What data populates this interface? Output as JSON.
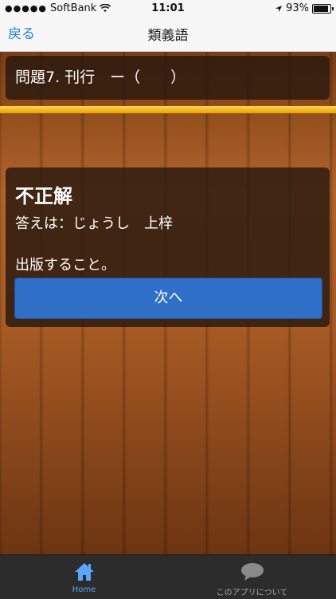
{
  "status": {
    "carrier": "SoftBank",
    "time": "11:01",
    "battery": "93%"
  },
  "nav": {
    "back_label": "戻る",
    "title": "類義語"
  },
  "question": {
    "text": "問題7. 刊行　ー（　　）"
  },
  "progress": {
    "fraction": 1.0
  },
  "result": {
    "title": "不正解",
    "answer": "答えは：じょうし　上梓",
    "meaning": "出版すること。",
    "next_label": "次へ"
  },
  "tabs": [
    {
      "label": "Home",
      "icon": "home-icon",
      "active": true
    },
    {
      "label": "このアプリについて",
      "icon": "speech-bubble-icon",
      "active": false
    }
  ],
  "colors": {
    "accent": "#1a7cf5",
    "button": "#2f6fc8",
    "progress": "#f2b600",
    "tab_active": "#56a8ff"
  }
}
